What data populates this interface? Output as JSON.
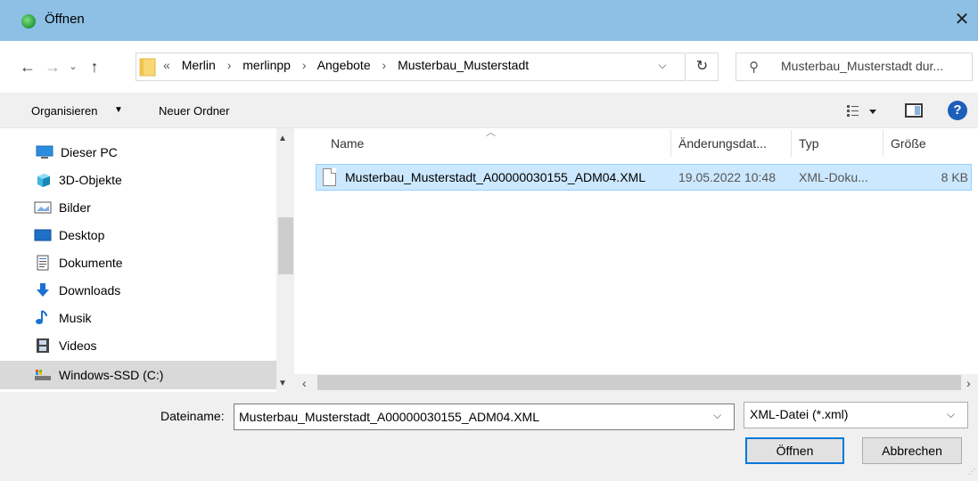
{
  "window": {
    "title": "Öffnen",
    "close_label": "✕"
  },
  "address": {
    "crumbs": [
      "«",
      "Merlin",
      "›",
      "merlinpp",
      "›",
      "Angebote",
      "›",
      "Musterbau_Musterstadt"
    ],
    "search_placeholder": "Musterbau_Musterstadt dur..."
  },
  "toolbar": {
    "organize_label": "Organisieren",
    "new_folder_label": "Neuer Ordner",
    "help_label": "?"
  },
  "nav": {
    "items": [
      {
        "label": "Dieser PC",
        "icon": "pc-icon"
      },
      {
        "label": "3D-Objekte",
        "icon": "3d-objects-icon"
      },
      {
        "label": "Bilder",
        "icon": "pictures-icon"
      },
      {
        "label": "Desktop",
        "icon": "desktop-icon"
      },
      {
        "label": "Dokumente",
        "icon": "documents-icon"
      },
      {
        "label": "Downloads",
        "icon": "downloads-icon"
      },
      {
        "label": "Musik",
        "icon": "music-icon"
      },
      {
        "label": "Videos",
        "icon": "videos-icon"
      },
      {
        "label": "Windows-SSD (C:)",
        "icon": "drive-icon"
      }
    ]
  },
  "filelist": {
    "columns": {
      "name": "Name",
      "date": "Änderungsdat...",
      "type": "Typ",
      "size": "Größe"
    },
    "rows": [
      {
        "name": "Musterbau_Musterstadt_A00000030155_ADM04.XML",
        "date": "19.05.2022 10:48",
        "type": "XML-Doku...",
        "size": "8 KB"
      }
    ]
  },
  "bottom": {
    "filename_label": "Dateiname:",
    "filename_value": "Musterbau_Musterstadt_A00000030155_ADM04.XML",
    "filetype_value": "XML-Datei (*.xml)",
    "open_label": "Öffnen",
    "cancel_label": "Abbrechen"
  },
  "colors": {
    "titlebar": "#8ec0e6",
    "selection": "#cce8ff",
    "accent": "#0078d7"
  }
}
